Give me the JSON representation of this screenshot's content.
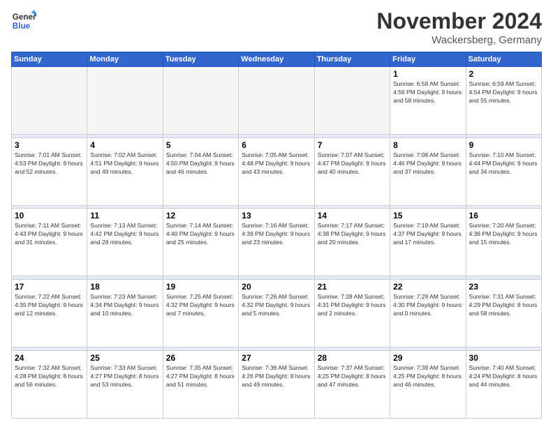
{
  "header": {
    "logo_line1": "General",
    "logo_line2": "Blue",
    "month": "November 2024",
    "location": "Wackersberg, Germany"
  },
  "days_of_week": [
    "Sunday",
    "Monday",
    "Tuesday",
    "Wednesday",
    "Thursday",
    "Friday",
    "Saturday"
  ],
  "weeks": [
    [
      {
        "day": "",
        "info": ""
      },
      {
        "day": "",
        "info": ""
      },
      {
        "day": "",
        "info": ""
      },
      {
        "day": "",
        "info": ""
      },
      {
        "day": "",
        "info": ""
      },
      {
        "day": "1",
        "info": "Sunrise: 6:58 AM\nSunset: 4:56 PM\nDaylight: 9 hours and 58 minutes."
      },
      {
        "day": "2",
        "info": "Sunrise: 6:59 AM\nSunset: 4:54 PM\nDaylight: 9 hours and 55 minutes."
      }
    ],
    [
      {
        "day": "3",
        "info": "Sunrise: 7:01 AM\nSunset: 4:53 PM\nDaylight: 9 hours and 52 minutes."
      },
      {
        "day": "4",
        "info": "Sunrise: 7:02 AM\nSunset: 4:51 PM\nDaylight: 9 hours and 49 minutes."
      },
      {
        "day": "5",
        "info": "Sunrise: 7:04 AM\nSunset: 4:50 PM\nDaylight: 9 hours and 46 minutes."
      },
      {
        "day": "6",
        "info": "Sunrise: 7:05 AM\nSunset: 4:48 PM\nDaylight: 9 hours and 43 minutes."
      },
      {
        "day": "7",
        "info": "Sunrise: 7:07 AM\nSunset: 4:47 PM\nDaylight: 9 hours and 40 minutes."
      },
      {
        "day": "8",
        "info": "Sunrise: 7:08 AM\nSunset: 4:46 PM\nDaylight: 9 hours and 37 minutes."
      },
      {
        "day": "9",
        "info": "Sunrise: 7:10 AM\nSunset: 4:44 PM\nDaylight: 9 hours and 34 minutes."
      }
    ],
    [
      {
        "day": "10",
        "info": "Sunrise: 7:11 AM\nSunset: 4:43 PM\nDaylight: 9 hours and 31 minutes."
      },
      {
        "day": "11",
        "info": "Sunrise: 7:13 AM\nSunset: 4:42 PM\nDaylight: 9 hours and 28 minutes."
      },
      {
        "day": "12",
        "info": "Sunrise: 7:14 AM\nSunset: 4:40 PM\nDaylight: 9 hours and 25 minutes."
      },
      {
        "day": "13",
        "info": "Sunrise: 7:16 AM\nSunset: 4:39 PM\nDaylight: 9 hours and 23 minutes."
      },
      {
        "day": "14",
        "info": "Sunrise: 7:17 AM\nSunset: 4:38 PM\nDaylight: 9 hours and 20 minutes."
      },
      {
        "day": "15",
        "info": "Sunrise: 7:19 AM\nSunset: 4:37 PM\nDaylight: 9 hours and 17 minutes."
      },
      {
        "day": "16",
        "info": "Sunrise: 7:20 AM\nSunset: 4:36 PM\nDaylight: 9 hours and 15 minutes."
      }
    ],
    [
      {
        "day": "17",
        "info": "Sunrise: 7:22 AM\nSunset: 4:35 PM\nDaylight: 9 hours and 12 minutes."
      },
      {
        "day": "18",
        "info": "Sunrise: 7:23 AM\nSunset: 4:34 PM\nDaylight: 9 hours and 10 minutes."
      },
      {
        "day": "19",
        "info": "Sunrise: 7:25 AM\nSunset: 4:32 PM\nDaylight: 9 hours and 7 minutes."
      },
      {
        "day": "20",
        "info": "Sunrise: 7:26 AM\nSunset: 4:32 PM\nDaylight: 9 hours and 5 minutes."
      },
      {
        "day": "21",
        "info": "Sunrise: 7:28 AM\nSunset: 4:31 PM\nDaylight: 9 hours and 2 minutes."
      },
      {
        "day": "22",
        "info": "Sunrise: 7:29 AM\nSunset: 4:30 PM\nDaylight: 9 hours and 0 minutes."
      },
      {
        "day": "23",
        "info": "Sunrise: 7:31 AM\nSunset: 4:29 PM\nDaylight: 8 hours and 58 minutes."
      }
    ],
    [
      {
        "day": "24",
        "info": "Sunrise: 7:32 AM\nSunset: 4:28 PM\nDaylight: 8 hours and 56 minutes."
      },
      {
        "day": "25",
        "info": "Sunrise: 7:33 AM\nSunset: 4:27 PM\nDaylight: 8 hours and 53 minutes."
      },
      {
        "day": "26",
        "info": "Sunrise: 7:35 AM\nSunset: 4:27 PM\nDaylight: 8 hours and 51 minutes."
      },
      {
        "day": "27",
        "info": "Sunrise: 7:36 AM\nSunset: 4:26 PM\nDaylight: 8 hours and 49 minutes."
      },
      {
        "day": "28",
        "info": "Sunrise: 7:37 AM\nSunset: 4:25 PM\nDaylight: 8 hours and 47 minutes."
      },
      {
        "day": "29",
        "info": "Sunrise: 7:39 AM\nSunset: 4:25 PM\nDaylight: 8 hours and 46 minutes."
      },
      {
        "day": "30",
        "info": "Sunrise: 7:40 AM\nSunset: 4:24 PM\nDaylight: 8 hours and 44 minutes."
      }
    ]
  ]
}
